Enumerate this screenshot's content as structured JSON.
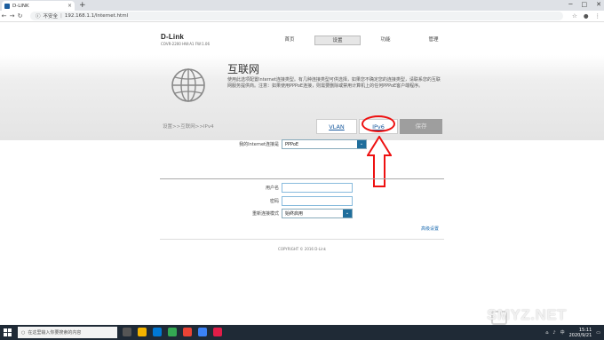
{
  "browser": {
    "tab_title": "D-LINK",
    "new_tab": "+",
    "url_security": "不安全",
    "url_separator": "|",
    "url": "192.168.1.1/Internet.html"
  },
  "router": {
    "logo": "D-Link",
    "model": "COVR-2200 HW:A1 FW:1.06",
    "nav": [
      "首页",
      "设置",
      "功能",
      "管理"
    ],
    "section_title": "互联网",
    "section_desc": "使用此选项配置Internet连接类型。有几种连接类型可供选择，如果您不确定您的连接类型，请联系您的互联网服务提供商。注意：如果使用PPPoE连接，则需要删除或禁用计算机上的任何PPPoE客户端程序。",
    "breadcrumb": "设置>>互联网>>IPv4",
    "tabs": {
      "vlan": "VLAN",
      "ipv6": "IPv6",
      "save": "保存"
    },
    "form": {
      "conn_type_label": "我的Internet连接是",
      "conn_type_value": "PPPoE",
      "username_label": "用户名",
      "password_label": "密码",
      "reconnect_label": "重新连接模式",
      "reconnect_value": "始终启用"
    },
    "advanced_link": "高级设置",
    "copyright": "COPYRIGHT © 2016 D-Link"
  },
  "taskbar": {
    "search_placeholder": "在这里输入你要搜索的内容",
    "time": "15:11",
    "date": "2020/9/21",
    "lang": "中"
  },
  "watermark": "SMYZ.NET",
  "colors": {
    "accent": "#1f6e9c",
    "highlight": "#e11111",
    "save_bg": "#9e9e9e"
  }
}
